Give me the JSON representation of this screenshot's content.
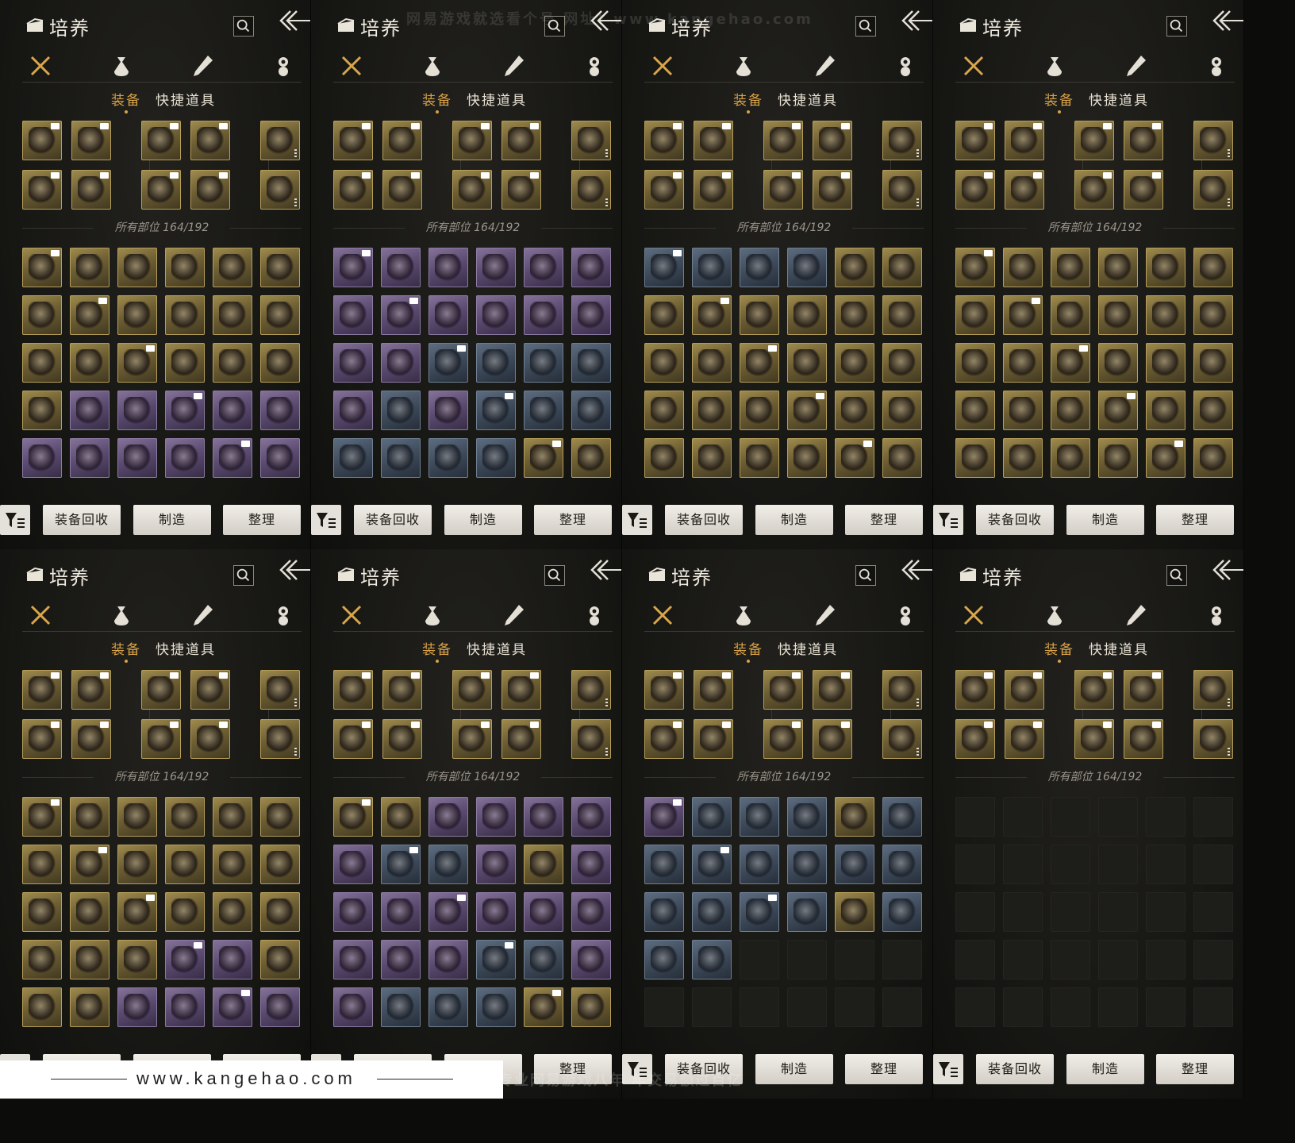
{
  "panel": {
    "title": "培养",
    "tab_equip": "装备",
    "tab_quick": "快捷道具",
    "slot_count": "所有部位 164/192",
    "btn_recycle": "装备回收",
    "btn_craft": "制造",
    "btn_sort": "整理",
    "categories": [
      "crossed-swords-icon",
      "pouch-icon",
      "scroll-icon",
      "tag-icon"
    ]
  },
  "watermark": {
    "top": "网易游戏就选看个号  网址：www.kangehao.com",
    "footer_url": "www.kangehao.com",
    "footer_text": "看个号专业网易游戏八年  年交易额过百亿"
  },
  "colors": {
    "accent": "#d7a248",
    "gold": "#a08c4f",
    "purple": "#86739a",
    "blue": "#5d6d80"
  },
  "inventory_pages": [
    [
      "gold",
      "gold",
      "gold",
      "gold",
      "gold",
      "gold",
      "gold",
      "gold",
      "gold",
      "gold",
      "gold",
      "gold",
      "gold",
      "gold",
      "gold",
      "gold",
      "gold",
      "gold",
      "gold",
      "purple",
      "purple",
      "purple",
      "purple",
      "purple",
      "purple",
      "purple",
      "purple",
      "purple",
      "purple",
      "purple"
    ],
    [
      "purple",
      "purple",
      "purple",
      "purple",
      "purple",
      "purple",
      "purple",
      "purple",
      "purple",
      "purple",
      "purple",
      "purple",
      "purple",
      "purple",
      "blue",
      "blue",
      "blue",
      "blue",
      "purple",
      "blue",
      "purple",
      "blue",
      "blue",
      "blue",
      "blue",
      "blue",
      "blue",
      "blue",
      "gold",
      "gold"
    ],
    [
      "blue",
      "blue",
      "blue",
      "blue",
      "gold",
      "gold",
      "gold",
      "gold",
      "gold",
      "gold",
      "gold",
      "gold",
      "gold",
      "gold",
      "gold",
      "gold",
      "gold",
      "gold",
      "gold",
      "gold",
      "gold",
      "gold",
      "gold",
      "gold",
      "gold",
      "gold",
      "gold",
      "gold",
      "gold",
      "gold"
    ],
    [
      "gold",
      "gold",
      "gold",
      "gold",
      "gold",
      "gold",
      "gold",
      "gold",
      "gold",
      "gold",
      "gold",
      "gold",
      "gold",
      "gold",
      "gold",
      "gold",
      "gold",
      "gold",
      "gold",
      "gold",
      "gold",
      "gold",
      "gold",
      "gold",
      "gold",
      "gold",
      "gold",
      "gold",
      "gold",
      "gold"
    ],
    [
      "gold",
      "gold",
      "gold",
      "gold",
      "gold",
      "gold",
      "gold",
      "gold",
      "gold",
      "gold",
      "gold",
      "gold",
      "gold",
      "gold",
      "gold",
      "gold",
      "gold",
      "gold",
      "gold",
      "gold",
      "gold",
      "purple",
      "purple",
      "gold",
      "gold",
      "gold",
      "purple",
      "purple",
      "purple",
      "purple"
    ],
    [
      "gold",
      "gold",
      "purple",
      "purple",
      "purple",
      "purple",
      "purple",
      "blue",
      "blue",
      "purple",
      "gold",
      "purple",
      "purple",
      "purple",
      "purple",
      "purple",
      "purple",
      "purple",
      "purple",
      "purple",
      "purple",
      "blue",
      "blue",
      "purple",
      "purple",
      "blue",
      "blue",
      "blue",
      "gold",
      "gold"
    ],
    [
      "purple",
      "blue",
      "blue",
      "blue",
      "gold",
      "blue",
      "blue",
      "blue",
      "blue",
      "blue",
      "blue",
      "blue",
      "blue",
      "blue",
      "blue",
      "blue",
      "gold",
      "blue",
      "blue",
      "blue",
      "empty",
      "empty",
      "empty",
      "empty",
      "empty",
      "empty",
      "empty",
      "empty",
      "empty",
      "empty"
    ],
    [
      "empty",
      "empty",
      "empty",
      "empty",
      "empty",
      "empty",
      "empty",
      "empty",
      "empty",
      "empty",
      "empty",
      "empty",
      "empty",
      "empty",
      "empty",
      "empty",
      "empty",
      "empty",
      "empty",
      "empty",
      "empty",
      "empty",
      "empty",
      "empty",
      "empty",
      "empty",
      "empty",
      "empty",
      "empty",
      "empty"
    ]
  ]
}
